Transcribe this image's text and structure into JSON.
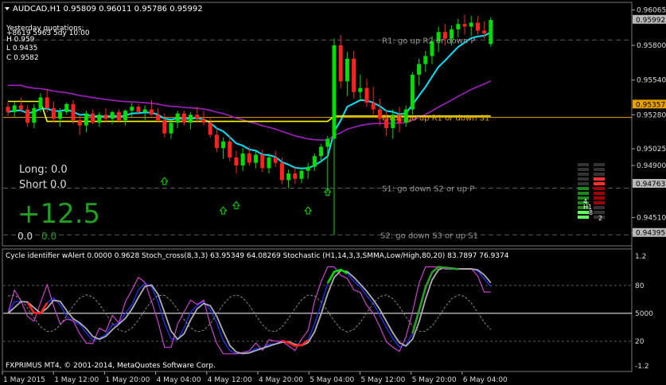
{
  "header": {
    "symbol_line": "AUDCAD,H1  0.95809 0.96011 0.95786 0.95992",
    "yesterday_label": "Yesterday quotations:",
    "overlap_text": "+8619 5963 5dy 10:00",
    "high": "H 0.959",
    "low": "L 0.9435",
    "close": "C 0.9582"
  },
  "trade_panel": {
    "long": "Long:  0.0",
    "short": "Short  0.0",
    "pnl": "+12.5",
    "bottom_left": "0.0",
    "bottom_right": "0.0"
  },
  "levels": [
    {
      "label": "R1: go up R2 or down P",
      "price": 0.9584
    },
    {
      "label": "Pivot: go up R1 or down S1",
      "price": 0.9526
    },
    {
      "label": "S1: go down S2 or up P",
      "price": 0.9473
    },
    {
      "label": "S2: go down S3 or up S1",
      "price": 0.9438
    }
  ],
  "price_axis": {
    "ticks": [
      "0.96065",
      "0.95800",
      "0.95540",
      "0.95280",
      "0.95025",
      "0.94900",
      "0.94510",
      "0.94395"
    ],
    "tick_values": [
      0.96065,
      0.958,
      0.9554,
      0.9528,
      0.95025,
      0.949,
      0.9451,
      0.94395
    ],
    "highlight_labels": [
      {
        "text": "0.95992",
        "value": 0.95992,
        "bg": "#b8b8b8",
        "fg": "#000000"
      },
      {
        "text": "0.95357",
        "value": 0.95357,
        "bg": "#e8a000",
        "fg": "#000000"
      },
      {
        "text": "0.94763",
        "value": 0.94763,
        "bg": "#b8b8b8",
        "fg": "#000000"
      },
      {
        "text": "0.94395",
        "value": 0.94395,
        "bg": "#b8b8b8",
        "fg": "#000000"
      }
    ]
  },
  "strength_meter": {
    "labels": [
      "4",
      "H1",
      "8",
      "2"
    ]
  },
  "indicator": {
    "title": "Cycle identifier wAlert 0.0000 0.9628  Stoch_cross(8,3,3) 63.95349 64.08269  Stochastic (H1,14,3,3,SMMA,Low/High,80,20) 83.7897 76.9374",
    "ticks": [
      "1.2",
      "80",
      "5000",
      "20",
      "-1.2"
    ],
    "tick_values": [
      1.2,
      80,
      50,
      20,
      -1.2
    ],
    "copyright": "FXPRIMUS MT4, © 2001-2014, MetaQuotes Software Corp."
  },
  "time_axis": {
    "labels": [
      "1 May 2015",
      "1 May 12:00",
      "1 May 20:00",
      "4 May 04:00",
      "4 May 12:00",
      "4 May 20:00",
      "5 May 04:00",
      "5 May 12:00",
      "5 May 20:00",
      "6 May 04:00"
    ]
  },
  "colors": {
    "bull": "#00e000",
    "bear": "#ff2020",
    "ma_cyan": "#00e5ff",
    "ma_purple": "#a020c0",
    "pivot_yellow": "#ffff00",
    "grid": "#5a5a5a"
  },
  "chart_data": {
    "type": "candlestick",
    "ylim": [
      0.9431,
      0.9611
    ],
    "candles": [
      [
        0.9534,
        0.9537,
        0.9527,
        0.953
      ],
      [
        0.953,
        0.9538,
        0.9526,
        0.9535
      ],
      [
        0.9535,
        0.9541,
        0.953,
        0.9532
      ],
      [
        0.9532,
        0.9535,
        0.9519,
        0.9522
      ],
      [
        0.9522,
        0.9536,
        0.9518,
        0.9533
      ],
      [
        0.9533,
        0.9544,
        0.953,
        0.9541
      ],
      [
        0.9541,
        0.9547,
        0.953,
        0.9533
      ],
      [
        0.9533,
        0.9538,
        0.9522,
        0.9525
      ],
      [
        0.9525,
        0.9533,
        0.9519,
        0.953
      ],
      [
        0.953,
        0.9537,
        0.9528,
        0.9536
      ],
      [
        0.9536,
        0.9539,
        0.9521,
        0.9524
      ],
      [
        0.9524,
        0.9528,
        0.9513,
        0.952
      ],
      [
        0.952,
        0.9531,
        0.9515,
        0.9529
      ],
      [
        0.9529,
        0.9532,
        0.9521,
        0.9522
      ],
      [
        0.9522,
        0.953,
        0.9519,
        0.9528
      ],
      [
        0.9528,
        0.9533,
        0.9522,
        0.9525
      ],
      [
        0.9525,
        0.9531,
        0.9521,
        0.953
      ],
      [
        0.953,
        0.9532,
        0.9522,
        0.9524
      ],
      [
        0.9524,
        0.9532,
        0.952,
        0.9531
      ],
      [
        0.9531,
        0.9537,
        0.9526,
        0.9534
      ],
      [
        0.9534,
        0.9536,
        0.9528,
        0.953
      ],
      [
        0.953,
        0.9535,
        0.9524,
        0.9532
      ],
      [
        0.9532,
        0.9539,
        0.9527,
        0.9528
      ],
      [
        0.9528,
        0.9533,
        0.9522,
        0.9524
      ],
      [
        0.9524,
        0.9529,
        0.9511,
        0.9514
      ],
      [
        0.9514,
        0.9524,
        0.951,
        0.9522
      ],
      [
        0.9522,
        0.9531,
        0.9518,
        0.9529
      ],
      [
        0.9529,
        0.9531,
        0.952,
        0.9522
      ],
      [
        0.9522,
        0.953,
        0.9517,
        0.9528
      ],
      [
        0.9528,
        0.9534,
        0.9522,
        0.9525
      ],
      [
        0.9525,
        0.9531,
        0.952,
        0.9522
      ],
      [
        0.9522,
        0.9526,
        0.9511,
        0.9513
      ],
      [
        0.9513,
        0.9518,
        0.95,
        0.9503
      ],
      [
        0.9503,
        0.9511,
        0.9495,
        0.9508
      ],
      [
        0.9508,
        0.9512,
        0.9493,
        0.9496
      ],
      [
        0.9496,
        0.9501,
        0.9484,
        0.949
      ],
      [
        0.949,
        0.9503,
        0.9486,
        0.9499
      ],
      [
        0.9499,
        0.9504,
        0.949,
        0.9492
      ],
      [
        0.9492,
        0.9501,
        0.9488,
        0.9498
      ],
      [
        0.9498,
        0.9502,
        0.9485,
        0.9488
      ],
      [
        0.9488,
        0.9499,
        0.9484,
        0.9496
      ],
      [
        0.9496,
        0.9501,
        0.9489,
        0.9492
      ],
      [
        0.9492,
        0.9496,
        0.9476,
        0.9479
      ],
      [
        0.9479,
        0.9487,
        0.9473,
        0.9484
      ],
      [
        0.9484,
        0.949,
        0.9476,
        0.948
      ],
      [
        0.948,
        0.9488,
        0.9477,
        0.9486
      ],
      [
        0.9486,
        0.9492,
        0.948,
        0.9489
      ],
      [
        0.9489,
        0.9499,
        0.9486,
        0.9497
      ],
      [
        0.9497,
        0.9506,
        0.9493,
        0.9504
      ],
      [
        0.9504,
        0.9512,
        0.947,
        0.951
      ],
      [
        0.951,
        0.9585,
        0.9438,
        0.958
      ],
      [
        0.958,
        0.9588,
        0.9548,
        0.9553
      ],
      [
        0.9553,
        0.9575,
        0.9542,
        0.957
      ],
      [
        0.957,
        0.9576,
        0.954,
        0.9545
      ],
      [
        0.9545,
        0.9558,
        0.9538,
        0.9548
      ],
      [
        0.9548,
        0.9555,
        0.9534,
        0.9537
      ],
      [
        0.9537,
        0.9549,
        0.9528,
        0.9532
      ],
      [
        0.9532,
        0.954,
        0.952,
        0.9525
      ],
      [
        0.9525,
        0.9532,
        0.9512,
        0.9518
      ],
      [
        0.9518,
        0.9532,
        0.951,
        0.9528
      ],
      [
        0.9528,
        0.9534,
        0.9515,
        0.9522
      ],
      [
        0.9522,
        0.9535,
        0.9519,
        0.9532
      ],
      [
        0.9532,
        0.956,
        0.9528,
        0.9558
      ],
      [
        0.9558,
        0.957,
        0.955,
        0.9566
      ],
      [
        0.9566,
        0.9576,
        0.956,
        0.9572
      ],
      [
        0.9572,
        0.9587,
        0.9566,
        0.9583
      ],
      [
        0.9583,
        0.9594,
        0.9575,
        0.959
      ],
      [
        0.959,
        0.9596,
        0.958,
        0.9585
      ],
      [
        0.9585,
        0.9595,
        0.958,
        0.9592
      ],
      [
        0.9592,
        0.96,
        0.9586,
        0.9596
      ],
      [
        0.9596,
        0.9603,
        0.9588,
        0.9594
      ],
      [
        0.9594,
        0.9602,
        0.9587,
        0.9597
      ],
      [
        0.9597,
        0.9602,
        0.9588,
        0.9591
      ],
      [
        0.9591,
        0.9598,
        0.9585,
        0.9589
      ],
      [
        0.9581,
        0.9601,
        0.9579,
        0.9599
      ]
    ]
  }
}
